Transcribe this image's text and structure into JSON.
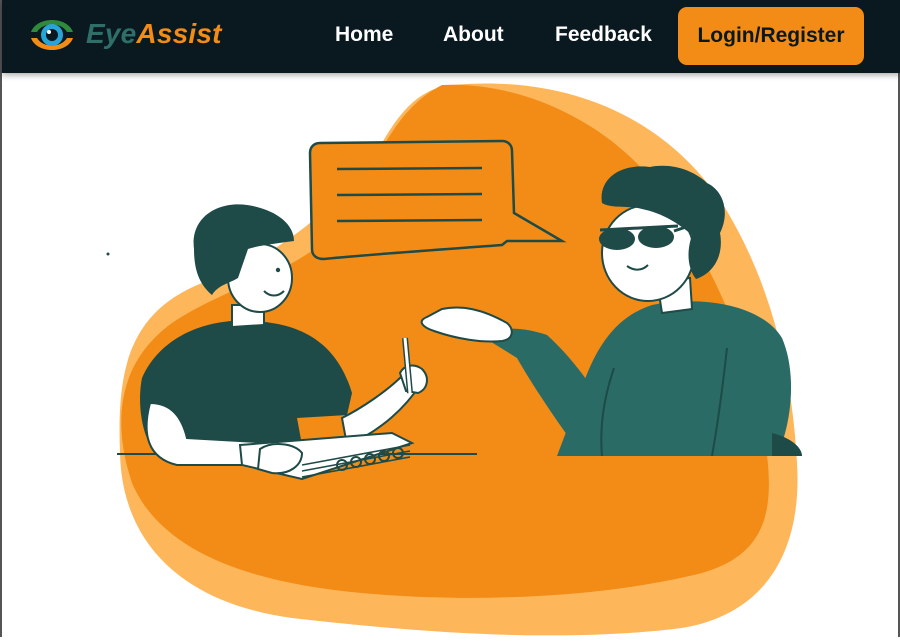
{
  "brand": {
    "part1": "Eye",
    "part2": "Assist"
  },
  "nav": {
    "home": "Home",
    "about": "About",
    "feedback": "Feedback",
    "login": "Login/Register"
  },
  "colors": {
    "navbar": "#0a1820",
    "accent": "#f28c16",
    "accent_light": "#fdb75a",
    "teal_dark": "#1e4a47",
    "teal": "#2a6b66"
  },
  "icons": {
    "logo": "eye-logo-icon"
  }
}
